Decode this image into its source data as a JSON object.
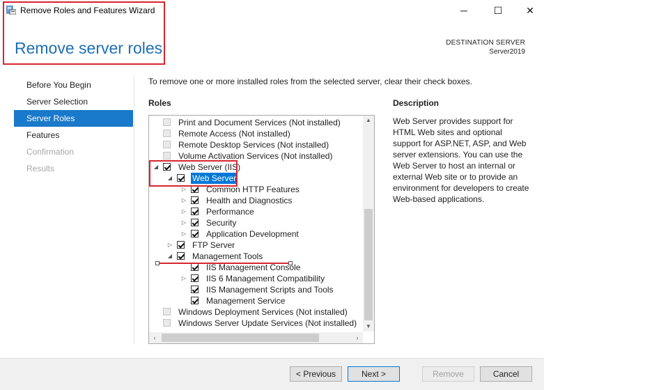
{
  "window": {
    "title": "Remove Roles and Features Wizard",
    "minimize_glyph": "─",
    "maximize_glyph": "☐",
    "close_glyph": "✕"
  },
  "header": {
    "page_title": "Remove server roles",
    "destination_label": "DESTINATION SERVER",
    "destination_value": "Server2019"
  },
  "nav": {
    "items": [
      {
        "label": "Before You Begin",
        "state": "normal"
      },
      {
        "label": "Server Selection",
        "state": "normal"
      },
      {
        "label": "Server Roles",
        "state": "active"
      },
      {
        "label": "Features",
        "state": "normal"
      },
      {
        "label": "Confirmation",
        "state": "disabled"
      },
      {
        "label": "Results",
        "state": "disabled"
      }
    ]
  },
  "main": {
    "instruction": "To remove one or more installed roles from the selected server, clear their check boxes.",
    "roles_heading": "Roles",
    "description_heading": "Description",
    "description_text": "Web Server provides support for HTML Web sites and optional support for ASP.NET, ASP, and Web server extensions. You can use the Web Server to host an internal or external Web site or to provide an environment for developers to create Web-based applications."
  },
  "tree": {
    "rows": [
      {
        "label": "Print and Document Services (Not installed)",
        "level": 0,
        "checked": false,
        "expander": ""
      },
      {
        "label": "Remote Access (Not installed)",
        "level": 0,
        "checked": false,
        "expander": ""
      },
      {
        "label": "Remote Desktop Services (Not installed)",
        "level": 0,
        "checked": false,
        "expander": ""
      },
      {
        "label": "Volume Activation Services (Not installed)",
        "level": 0,
        "checked": false,
        "expander": ""
      },
      {
        "label": "Web Server (IIS)",
        "level": 0,
        "checked": true,
        "expander": "expanded"
      },
      {
        "label": "Web Server",
        "level": 1,
        "checked": true,
        "expander": "expanded",
        "selected": true
      },
      {
        "label": "Common HTTP Features",
        "level": 2,
        "checked": true,
        "expander": "collapsed"
      },
      {
        "label": "Health and Diagnostics",
        "level": 2,
        "checked": true,
        "expander": "collapsed"
      },
      {
        "label": "Performance",
        "level": 2,
        "checked": true,
        "expander": "collapsed"
      },
      {
        "label": "Security",
        "level": 2,
        "checked": true,
        "expander": "collapsed"
      },
      {
        "label": "Application Development",
        "level": 2,
        "checked": true,
        "expander": "collapsed"
      },
      {
        "label": "FTP Server",
        "level": 1,
        "checked": true,
        "expander": "collapsed"
      },
      {
        "label": "Management Tools",
        "level": 1,
        "checked": true,
        "expander": "expanded"
      },
      {
        "label": "IIS Management Console",
        "level": 2,
        "checked": true,
        "expander": ""
      },
      {
        "label": "IIS 6 Management Compatibility",
        "level": 2,
        "checked": true,
        "expander": "collapsed"
      },
      {
        "label": "IIS Management Scripts and Tools",
        "level": 2,
        "checked": true,
        "expander": ""
      },
      {
        "label": "Management Service",
        "level": 2,
        "checked": true,
        "expander": ""
      },
      {
        "label": "Windows Deployment Services (Not installed)",
        "level": 0,
        "checked": false,
        "expander": ""
      },
      {
        "label": "Windows Server Update Services (Not installed)",
        "level": 0,
        "checked": false,
        "expander": ""
      }
    ]
  },
  "footer": {
    "previous_label": "< Previous",
    "next_label": "Next >",
    "remove_label": "Remove",
    "cancel_label": "Cancel"
  },
  "colors": {
    "accent": "#1979ca",
    "annotation": "#d7262f",
    "title_blue": "#1e6fb4"
  }
}
